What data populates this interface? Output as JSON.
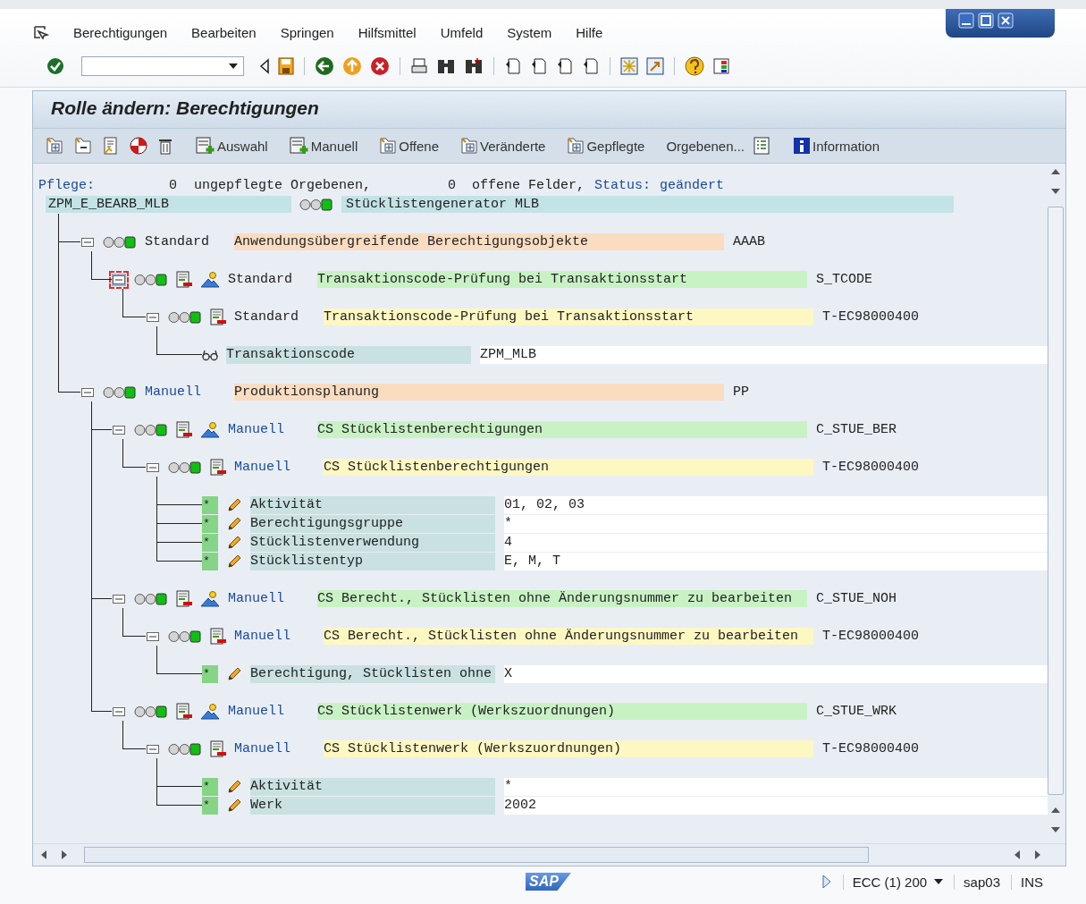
{
  "menu_bar": {
    "items": [
      "Berechtigungen",
      "Bearbeiten",
      "Springen",
      "Hilfsmittel",
      "Umfeld",
      "System",
      "Hilfe"
    ]
  },
  "title": "Rolle ändern: Berechtigungen",
  "app_toolbar": {
    "buttons": [
      {
        "label": "Auswahl"
      },
      {
        "label": "Manuell"
      },
      {
        "label": "Offene"
      },
      {
        "label": "Veränderte"
      },
      {
        "label": "Gepflegte"
      },
      {
        "label": "Orgebenen..."
      },
      {
        "label": "Information"
      }
    ]
  },
  "summary": {
    "label": "Pflege:",
    "unmaintained_count": "0",
    "unmaintained_text": "ungepflegte Orgebenen,",
    "open_count": "0",
    "open_text": "offene Felder,",
    "status_label": "Status:",
    "status": "geändert"
  },
  "role": {
    "name": "ZPM_E_BEARB_MLB",
    "color": "#10c010",
    "description": "Stücklistengenerator MLB"
  },
  "tree": [
    {
      "kind": "class",
      "expanded": true,
      "selected": false,
      "color": "#10c010",
      "origin": "Standard",
      "manual": false,
      "description": "Anwendungsübergreifende Berechtigungsobjekte",
      "code": "AAAB",
      "children": [
        {
          "kind": "object",
          "expanded": true,
          "selected": true,
          "color": "#10c010",
          "origin": "Standard",
          "manual": false,
          "description": "Transaktionscode-Prüfung bei Transaktionsstart",
          "code": "S_TCODE",
          "children": [
            {
              "kind": "authorization",
              "expanded": true,
              "selected": false,
              "color": "#10c010",
              "origin": "Standard",
              "manual": false,
              "description": "Transaktionscode-Prüfung bei Transaktionsstart",
              "code": "T-EC98000400",
              "children": [
                {
                  "kind": "org_field",
                  "label": "Transaktionscode",
                  "value": "ZPM_MLB"
                }
              ]
            }
          ]
        }
      ]
    },
    {
      "kind": "class",
      "expanded": true,
      "selected": false,
      "color": "#10c010",
      "origin": "Manuell",
      "manual": true,
      "description": "Produktionsplanung",
      "code": "PP",
      "children": [
        {
          "kind": "object",
          "expanded": true,
          "selected": false,
          "color": "#10c010",
          "origin": "Manuell",
          "manual": true,
          "description": "CS Stücklistenberechtigungen",
          "code": "C_STUE_BER",
          "children": [
            {
              "kind": "authorization",
              "expanded": true,
              "selected": false,
              "color": "#10c010",
              "origin": "Manuell",
              "manual": true,
              "description": "CS Stücklistenberechtigungen",
              "code": "T-EC98000400",
              "children": [
                {
                  "kind": "value_field",
                  "marker": "*",
                  "label": "Aktivität",
                  "value": "01, 02, 03"
                },
                {
                  "kind": "value_field",
                  "marker": "*",
                  "label": "Berechtigungsgruppe",
                  "value": "*"
                },
                {
                  "kind": "value_field",
                  "marker": "*",
                  "label": "Stücklistenverwendung",
                  "value": "4"
                },
                {
                  "kind": "value_field",
                  "marker": "*",
                  "label": "Stücklistentyp",
                  "value": "E, M, T"
                }
              ]
            }
          ]
        },
        {
          "kind": "object",
          "expanded": true,
          "selected": false,
          "color": "#10c010",
          "origin": "Manuell",
          "manual": true,
          "description": "CS Berecht., Stücklisten ohne Änderungsnummer zu bearbeiten",
          "code": "C_STUE_NOH",
          "children": [
            {
              "kind": "authorization",
              "expanded": true,
              "selected": false,
              "color": "#10c010",
              "origin": "Manuell",
              "manual": true,
              "description": "CS Berecht., Stücklisten ohne Änderungsnummer zu bearbeiten",
              "code": "T-EC98000400",
              "children": [
                {
                  "kind": "value_field",
                  "marker": "*",
                  "label": "Berechtigung, Stücklisten ohne",
                  "value": "X"
                }
              ]
            }
          ]
        },
        {
          "kind": "object",
          "expanded": true,
          "selected": false,
          "color": "#10c010",
          "origin": "Manuell",
          "manual": true,
          "description": "CS Stücklistenwerk (Werkszuordnungen)",
          "code": "C_STUE_WRK",
          "children": [
            {
              "kind": "authorization",
              "expanded": true,
              "selected": false,
              "color": "#10c010",
              "origin": "Manuell",
              "manual": true,
              "description": "CS Stücklistenwerk (Werkszuordnungen)",
              "code": "T-EC98000400",
              "children": [
                {
                  "kind": "value_field",
                  "marker": "*",
                  "label": "Aktivität",
                  "value": "*"
                },
                {
                  "kind": "value_field",
                  "marker": "*",
                  "label": "Werk",
                  "value": "2002"
                }
              ]
            }
          ]
        }
      ]
    }
  ],
  "status_bar": {
    "logo": "SAP",
    "system": "ECC (1) 200",
    "server": "sap03",
    "mode": "INS"
  }
}
